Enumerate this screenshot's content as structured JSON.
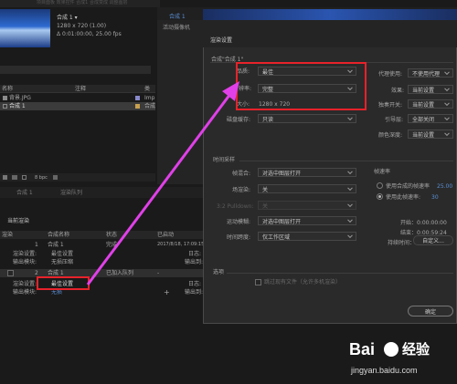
{
  "project": {
    "comp_name": "合成 1 ▾",
    "comp_size": "1280 x 720 (1.00)",
    "comp_duration": "Δ 0:01:00:00, 25.00 fps",
    "top_tabs": "项目面板  效果控件 合成1 合成变成 调整图层",
    "cols": {
      "name": "名称",
      "comment": "注释",
      "type": "类"
    },
    "items": [
      {
        "name": "背景.JPG",
        "type": "Imp"
      },
      {
        "name": "合成 1",
        "type": "合成"
      }
    ],
    "bpc": "8 bpc"
  },
  "viewer": {
    "tab": "合成 1",
    "label": "活动摄像机"
  },
  "bottom": {
    "tab1": "合成 1",
    "tab2": "渲染队列",
    "title": "当前渲染",
    "cols": {
      "render": "渲染",
      "comp": "合成名称",
      "status": "状态",
      "started": "已启动"
    },
    "rows": [
      {
        "num": "1",
        "name": "合成 1",
        "status": "完成",
        "started": "2017/8/18, 17:09:15"
      },
      {
        "num": "2",
        "name": "合成 1",
        "status": "已加入队列",
        "started": "-"
      }
    ],
    "settings_label": "渲染设置:",
    "settings_value": "最佳设置",
    "output_label": "输出模块:",
    "output_value": "无损压缩",
    "output_value2": "无损",
    "log_label": "日志:",
    "log_label2": "日志:",
    "output_to": "输出到:",
    "output_to2": "输出到:"
  },
  "dialog": {
    "title": "渲染设置",
    "comp_label": "合成\"合成 1\"",
    "quality_label": "品质:",
    "quality_value": "最佳",
    "resolution_label": "分辨率:",
    "resolution_value": "完整",
    "size_label": "大小:",
    "size_value": "1280 x 720",
    "disk_label": "磁盘缓存:",
    "disk_value": "只读",
    "proxy_label": "代理使用:",
    "proxy_value": "不使用代理",
    "effects_label": "效果:",
    "effects_value": "当前设置",
    "solo_label": "独奏开关:",
    "solo_value": "当前设置",
    "guide_label": "引导层:",
    "guide_value": "全部关闭",
    "color_label": "颜色深度:",
    "color_value": "当前设置",
    "time_section": "时间采样",
    "frame_blend_label": "帧混合:",
    "frame_blend_value": "对选中图层打开",
    "field_label": "场渲染:",
    "field_value": "关",
    "pulldown_label": "3:2 Pulldown:",
    "pulldown_value": "关",
    "motion_blur_label": "运动模糊:",
    "motion_blur_value": "对选中图层打开",
    "time_span_label": "时间跨度:",
    "time_span_value": "仅工作区域",
    "framerate_title": "帧速率",
    "use_comp_rate": "使用合成的帧速率",
    "comp_rate_value": "25.00",
    "use_this_rate": "使用此帧速率:",
    "this_rate_value": "30",
    "start_label": "开始：0:00:00:00",
    "end_label": "结束：0:00:59:24",
    "duration_label": "持续时间：0:00:00:00",
    "custom_btn": "自定义...",
    "options_section": "选项",
    "skip_label": "跳过现有文件（允许多机渲染）",
    "ok_label": "确定"
  },
  "watermark": {
    "brand": "Bai",
    "brand2": "经验",
    "url": "jingyan.baidu.com"
  },
  "colors": {
    "highlight": "#e8222a",
    "arrow": "#e040e8"
  }
}
